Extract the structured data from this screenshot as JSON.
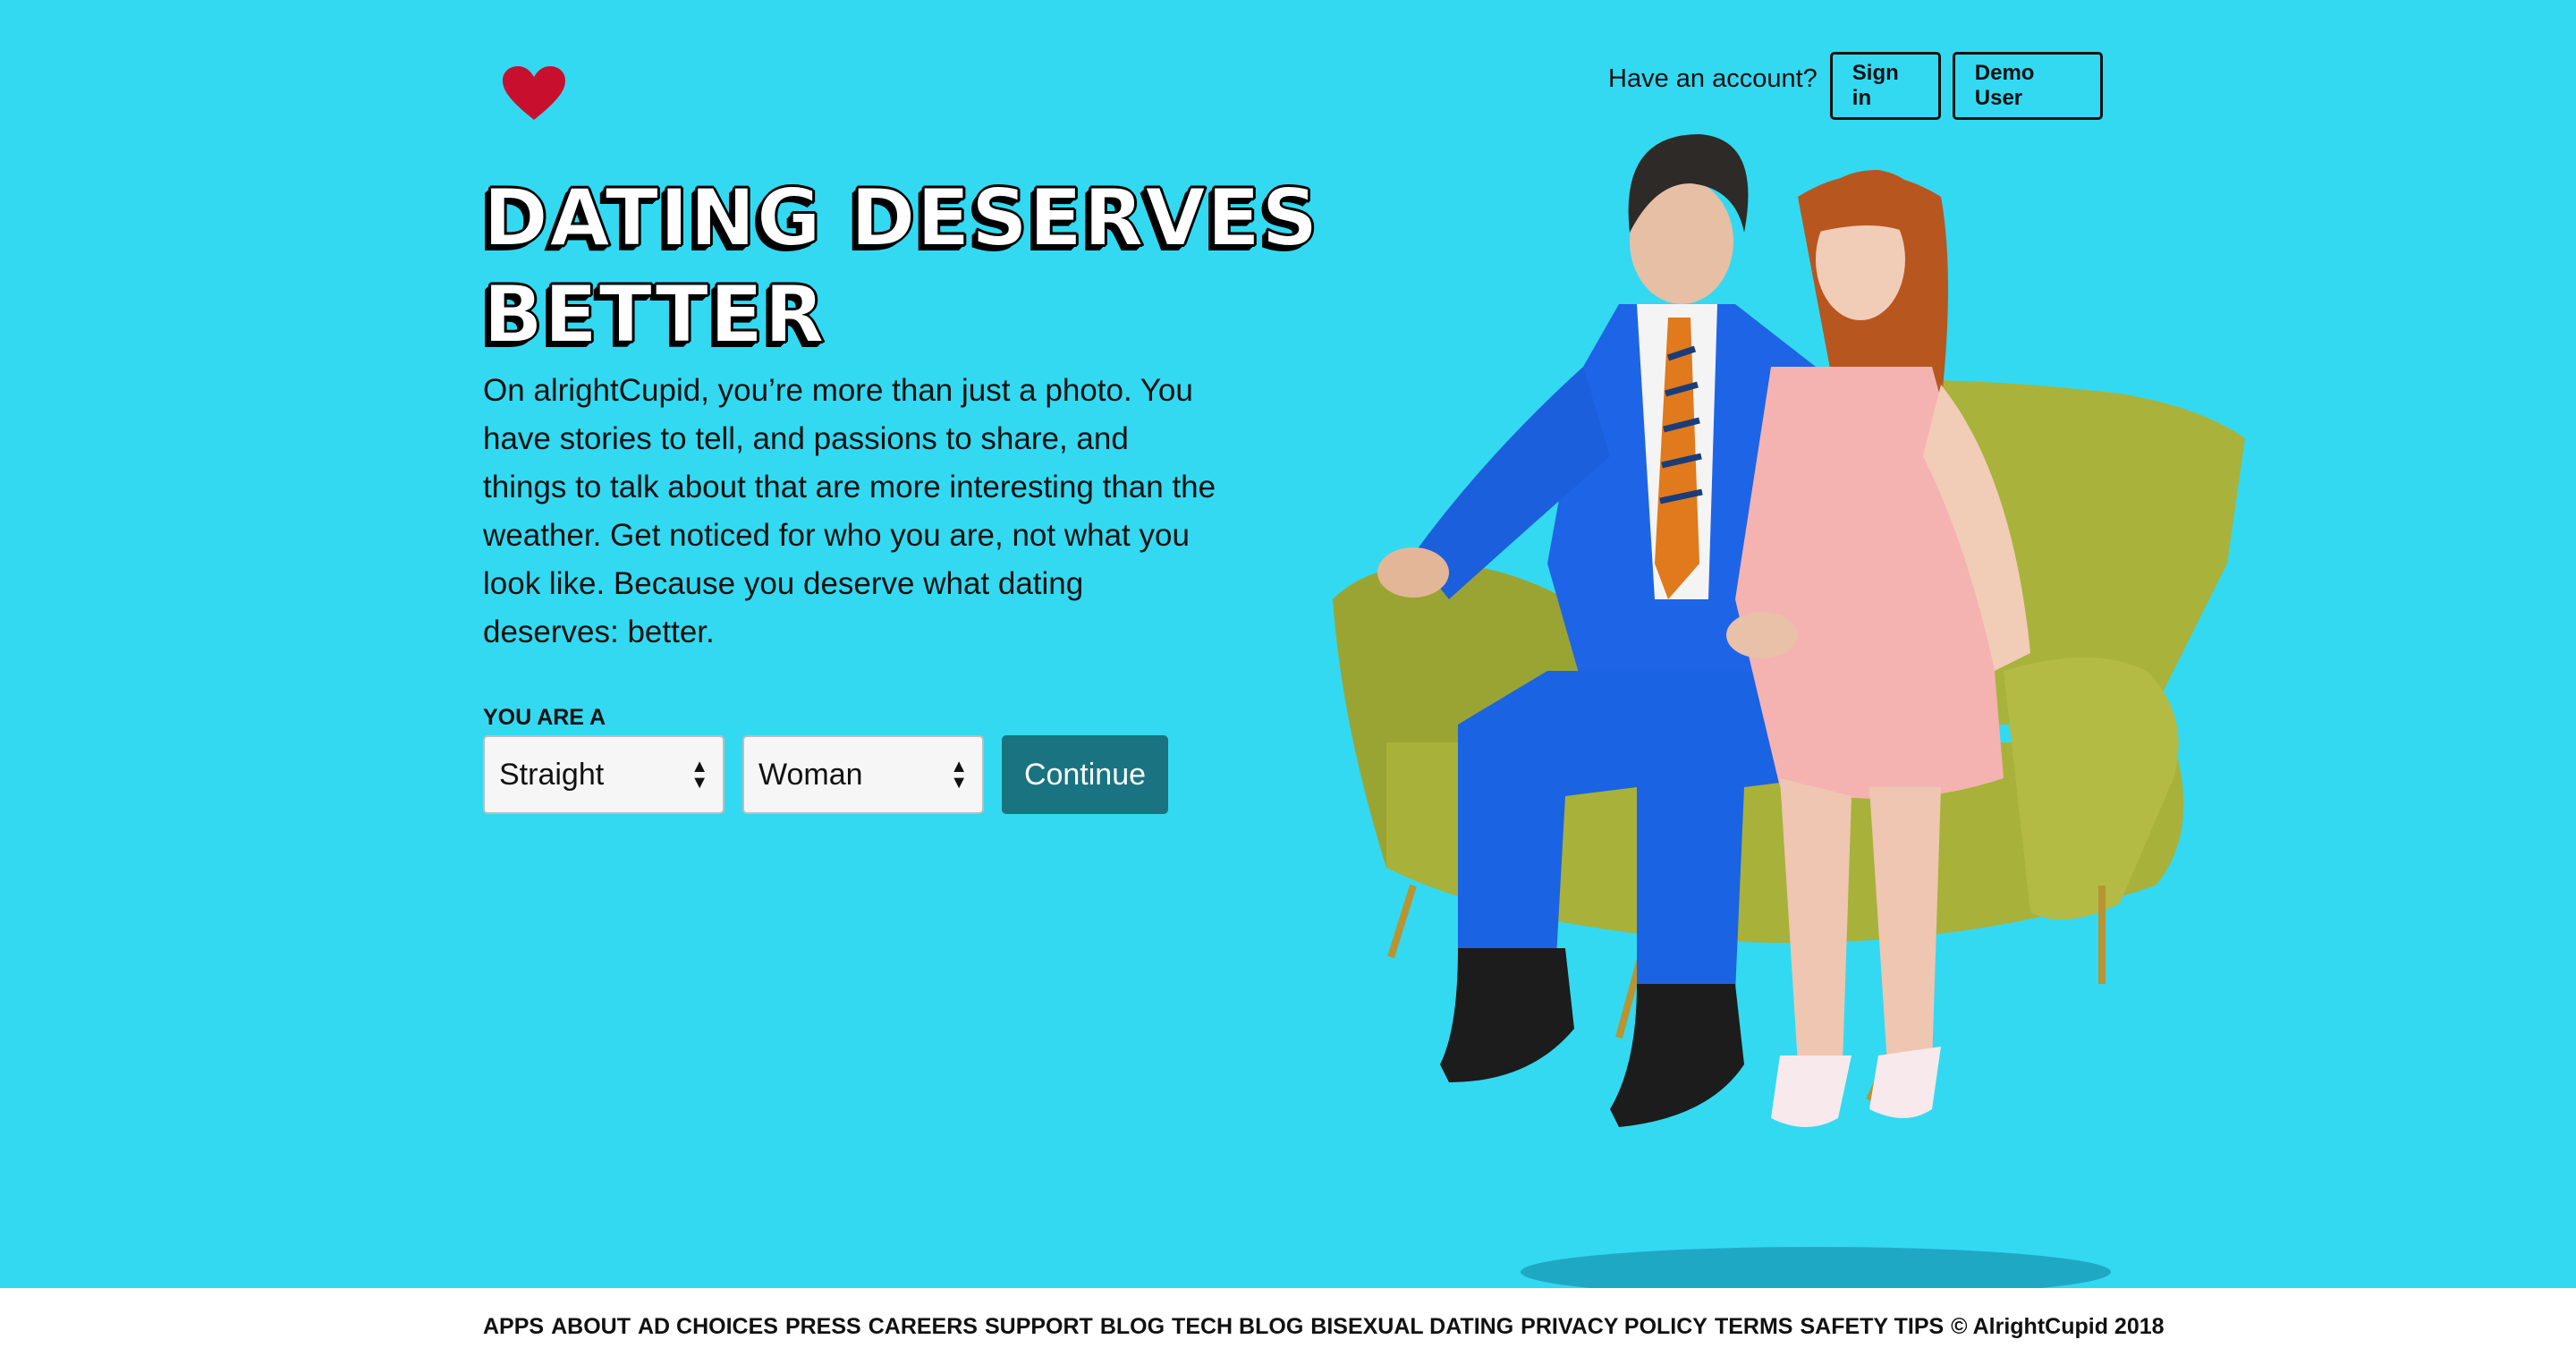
{
  "header": {
    "logo_icon": "heart-icon",
    "account_prompt": "Have an account?",
    "sign_in_label": "Sign in",
    "demo_user_label": "Demo User"
  },
  "hero": {
    "headline_line1": "DATING DESERVES",
    "headline_line2": "BETTER",
    "body": "On alrightCupid, you’re more than just a photo. You have stories to tell, and passions to share, and things to talk about that are more interesting than the weather. Get noticed for who you are, not what you look like. Because you deserve what dating deserves: better."
  },
  "form": {
    "label": "YOU ARE A",
    "orientation_value": "Straight",
    "gender_value": "Woman",
    "continue_label": "Continue"
  },
  "footer": {
    "links": [
      "APPS",
      "ABOUT",
      "AD CHOICES",
      "PRESS",
      "CAREERS",
      "SUPPORT",
      "BLOG",
      "TECH BLOG",
      "BISEXUAL DATING",
      "PRIVACY POLICY",
      "TERMS",
      "SAFETY TIPS"
    ],
    "copyright": "© AlrightCupid 2018"
  },
  "colors": {
    "background": "#33d9f1",
    "button_primary": "#1a7380",
    "logo": "#c8102e"
  }
}
